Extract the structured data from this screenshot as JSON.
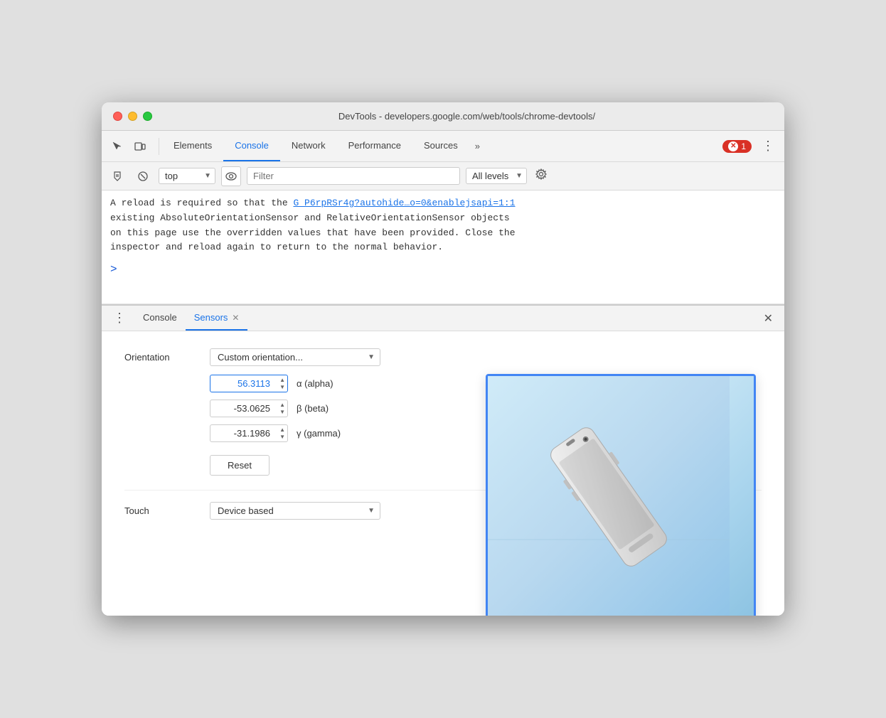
{
  "window": {
    "title": "DevTools - developers.google.com/web/tools/chrome-devtools/"
  },
  "toolbar": {
    "tabs": [
      {
        "id": "elements",
        "label": "Elements",
        "active": false
      },
      {
        "id": "console",
        "label": "Console",
        "active": true
      },
      {
        "id": "network",
        "label": "Network",
        "active": false
      },
      {
        "id": "performance",
        "label": "Performance",
        "active": false
      },
      {
        "id": "sources",
        "label": "Sources",
        "active": false
      }
    ],
    "more_label": "»",
    "error_count": "1",
    "more_menu": "⋮"
  },
  "console_toolbar": {
    "context_options": [
      "top"
    ],
    "context_value": "top",
    "filter_placeholder": "Filter",
    "levels_label": "All levels"
  },
  "console_output": {
    "message_line1": "A reload is required so that the ",
    "message_link": "G_P6rpRSr4g?autohide…o=0&enablejsapi=1:1",
    "message_line2": "existing AbsoluteOrientationSensor and RelativeOrientationSensor objects",
    "message_line3": "on this page use the overridden values that have been provided. Close the",
    "message_line4": "inspector and reload again to return to the normal behavior.",
    "prompt_symbol": ">"
  },
  "bottom_tabs": [
    {
      "id": "console",
      "label": "Console",
      "closeable": false,
      "active": false
    },
    {
      "id": "sensors",
      "label": "Sensors",
      "closeable": true,
      "active": true
    }
  ],
  "sensors": {
    "orientation_label": "Orientation",
    "orientation_value": "Custom orientation...",
    "alpha_value": "56.3113",
    "alpha_label": "α (alpha)",
    "beta_value": "-53.0625",
    "beta_label": "β (beta)",
    "gamma_value": "-31.1986",
    "gamma_label": "γ (gamma)",
    "reset_label": "Reset",
    "touch_label": "Touch",
    "touch_value": "Device based"
  }
}
